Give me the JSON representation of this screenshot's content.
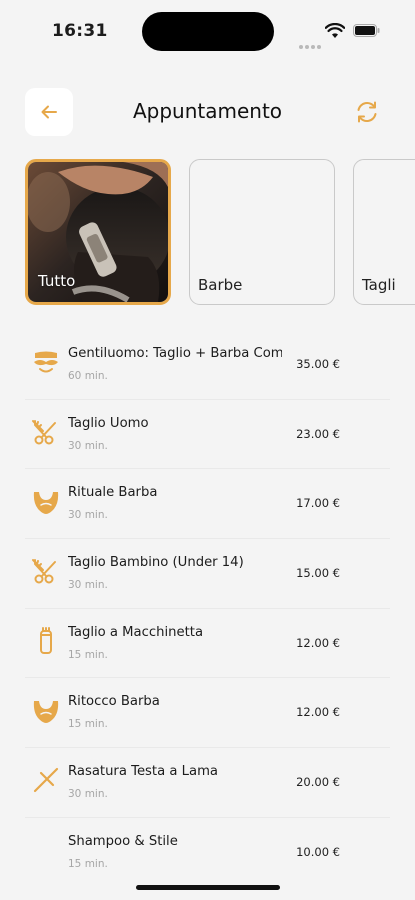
{
  "status_bar": {
    "time": "16:31"
  },
  "header": {
    "title": "Appuntamento"
  },
  "categories": [
    {
      "label": "Tutto",
      "selected": true
    },
    {
      "label": "Barbe",
      "selected": false
    },
    {
      "label": "Tagli",
      "selected": false
    }
  ],
  "services": [
    {
      "name": "Gentiluomo: Taglio + Barba Completo",
      "duration": "60 min.",
      "price": "35.00 €",
      "icon": "mustache-icon"
    },
    {
      "name": "Taglio Uomo",
      "duration": "30 min.",
      "price": "23.00 €",
      "icon": "scissors-comb-icon"
    },
    {
      "name": "Rituale Barba",
      "duration": "30 min.",
      "price": "17.00 €",
      "icon": "beard-icon"
    },
    {
      "name": "Taglio Bambino (Under 14)",
      "duration": "30 min.",
      "price": "15.00 €",
      "icon": "scissors-comb-icon"
    },
    {
      "name": "Taglio a Macchinetta",
      "duration": "15 min.",
      "price": "12.00 €",
      "icon": "clipper-icon"
    },
    {
      "name": "Ritocco Barba",
      "duration": "15 min.",
      "price": "12.00 €",
      "icon": "beard-icon"
    },
    {
      "name": "Rasatura Testa a Lama",
      "duration": "30 min.",
      "price": "20.00 €",
      "icon": "razor-icon"
    },
    {
      "name": "Shampoo & Stile",
      "duration": "15 min.",
      "price": "10.00 €",
      "icon": "none"
    }
  ],
  "colors": {
    "accent": "#e6a84a",
    "background": "#f4f4f4",
    "text": "#1c1c1c",
    "muted": "#a6a6a6"
  }
}
